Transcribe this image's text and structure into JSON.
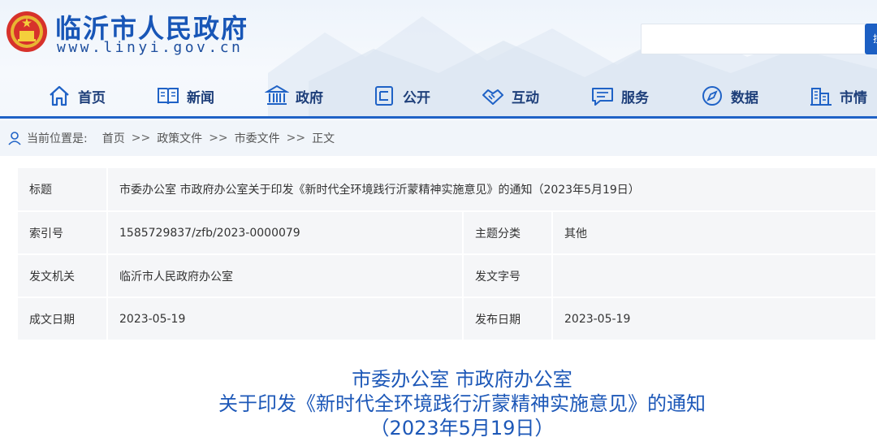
{
  "header": {
    "site_title": "临沂市人民政府",
    "site_url": "www.linyi.gov.cn",
    "search": {
      "placeholder": "",
      "button_label": "搜"
    }
  },
  "nav": [
    {
      "label": "首页",
      "icon": "home-icon"
    },
    {
      "label": "新闻",
      "icon": "book-icon"
    },
    {
      "label": "政府",
      "icon": "building-icon"
    },
    {
      "label": "公开",
      "icon": "document-icon"
    },
    {
      "label": "互动",
      "icon": "handshake-icon"
    },
    {
      "label": "服务",
      "icon": "chat-icon"
    },
    {
      "label": "数据",
      "icon": "compass-icon"
    },
    {
      "label": "市情",
      "icon": "city-icon"
    }
  ],
  "breadcrumb": {
    "prefix": "当前位置是:",
    "items": [
      "首页",
      "政策文件",
      "市委文件",
      "正文"
    ],
    "separator": ">>"
  },
  "info": {
    "title_label": "标题",
    "title_value": "市委办公室 市政府办公室关于印发《新时代全环境践行沂蒙精神实施意见》的通知（2023年5月19日）",
    "index_label": "索引号",
    "index_value": "1585729837/zfb/2023-0000079",
    "topic_label": "主题分类",
    "topic_value": "其他",
    "issuer_label": "发文机关",
    "issuer_value": "临沂市人民政府办公室",
    "docno_label": "发文字号",
    "docno_value": "",
    "written_label": "成文日期",
    "written_value": "2023-05-19",
    "published_label": "发布日期",
    "published_value": "2023-05-19"
  },
  "document": {
    "title_lines": [
      "市委办公室 市政府办公室",
      "关于印发《新时代全环境践行沂蒙精神实施意见》的通知",
      "（2023年5月19日）"
    ]
  },
  "colors": {
    "brand_blue": "#1f62c6",
    "title_blue": "#1d58b8",
    "nav_text": "#1e3f7a"
  }
}
